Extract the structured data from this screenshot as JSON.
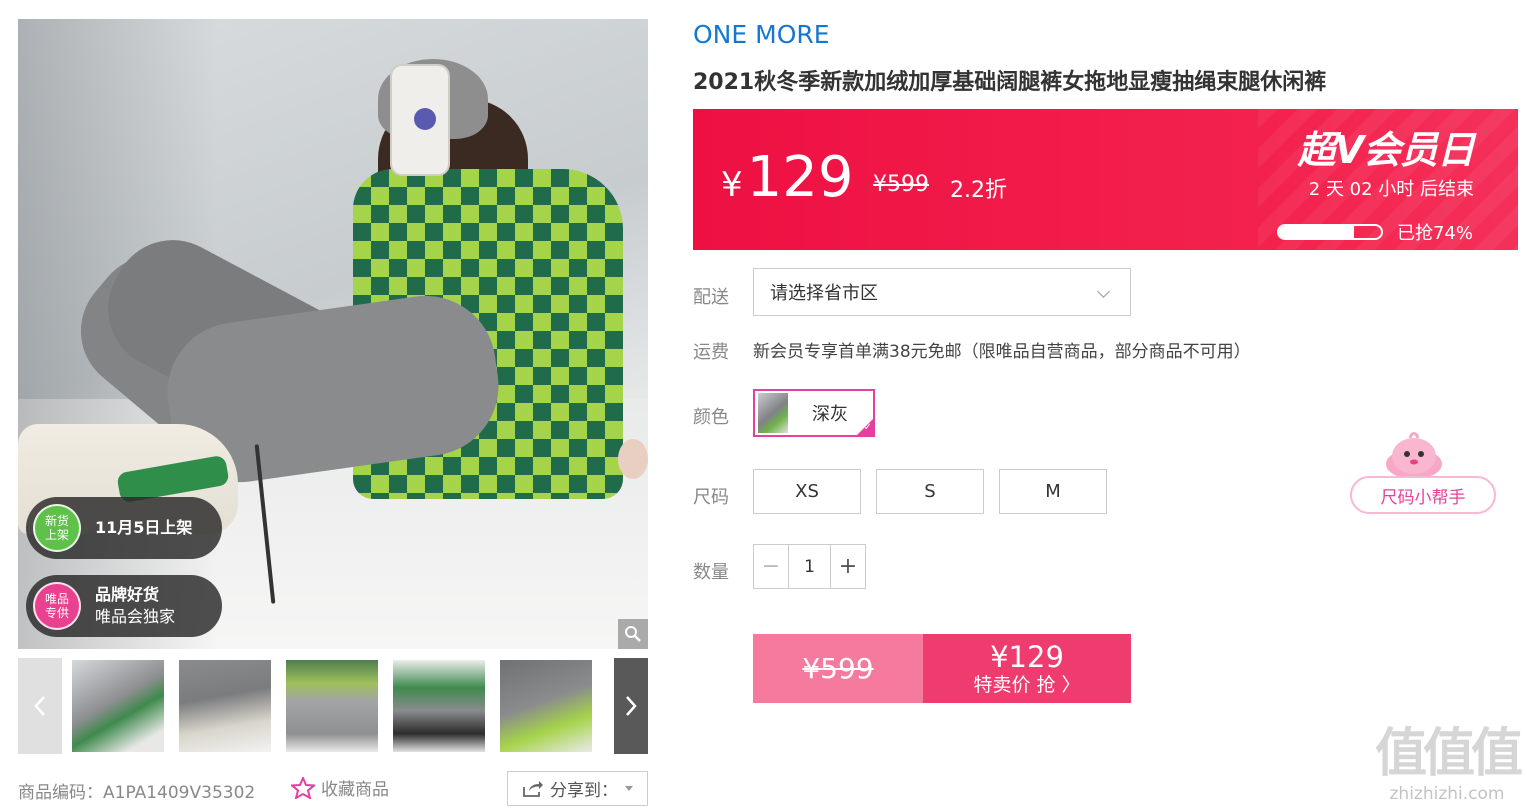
{
  "gallery": {
    "badges": [
      {
        "icon_line1": "新货",
        "icon_line2": "上架",
        "line1": "11月5日上架",
        "line2": ""
      },
      {
        "icon_line1": "唯品",
        "icon_line2": "专供",
        "line1": "品牌好货",
        "line2": "唯品会独家"
      }
    ],
    "thumbnails": [
      "thumb-1",
      "thumb-2",
      "thumb-3",
      "thumb-4",
      "thumb-5"
    ]
  },
  "meta": {
    "sku_text": "商品编码：A1PA1409V35302",
    "favorite_label": "收藏商品",
    "share_label": "分享到："
  },
  "product": {
    "brand": "ONE MORE",
    "title": "2021秋冬季新款加绒加厚基础阔腿裤女拖地显瘦抽绳束腿休闲裤"
  },
  "price_band": {
    "currency": "¥",
    "price": "129",
    "original_price": "¥599",
    "discount": "2.2折",
    "event_title": "超V会员日",
    "countdown": "2 天 02 小时 后结束",
    "sold_percent": 74,
    "sold_label": "已抢74%"
  },
  "options": {
    "shipping_label": "配送",
    "shipping_placeholder": "请选择省市区",
    "freight_label": "运费",
    "freight_text": "新会员专享首单满38元免邮（限唯品自营商品，部分商品不可用）",
    "color_label": "颜色",
    "color_value": "深灰",
    "size_label": "尺码",
    "sizes": [
      "XS",
      "S",
      "M"
    ],
    "size_helper": "尺码小帮手",
    "qty_label": "数量",
    "qty_value": "1",
    "qty_minus": "−",
    "qty_plus": "+"
  },
  "buy": {
    "original_price": "¥599",
    "price": "¥129",
    "cta": "特卖价 抢 〉"
  },
  "watermark": {
    "logo": "值值值",
    "url": "zhizhizhi.com"
  },
  "colors": {
    "brand_blue": "#1478d2",
    "price_red": "#ee1043",
    "accent_pink": "#e63f9e",
    "buy_pink": "#ee3c6e",
    "buy_light_pink": "#f57a9d"
  }
}
